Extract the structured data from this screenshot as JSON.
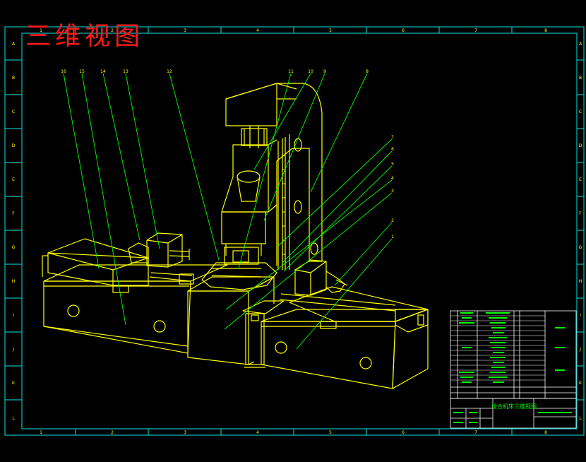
{
  "drawing": {
    "title": "三维视图",
    "columns": [
      "1",
      "2",
      "3",
      "4",
      "5",
      "6",
      "7",
      "8"
    ],
    "rows": [
      "A",
      "B",
      "C",
      "D",
      "E",
      "F",
      "G",
      "H",
      "I",
      "J",
      "K",
      "L"
    ],
    "balloons_top": [
      "16",
      "15",
      "14",
      "13",
      "12",
      "11",
      "10",
      "9",
      "8"
    ],
    "balloons_right": [
      "7",
      "6",
      "5",
      "4",
      "3",
      "2",
      "1"
    ],
    "title_block_name": "组合机床三维视图"
  },
  "colors": {
    "background": "#000000",
    "frame": "#00e5e5",
    "machine": "#ffff00",
    "leaders": "#00ff00",
    "title": "#ff1a1a",
    "title_block": "#00ff00"
  }
}
